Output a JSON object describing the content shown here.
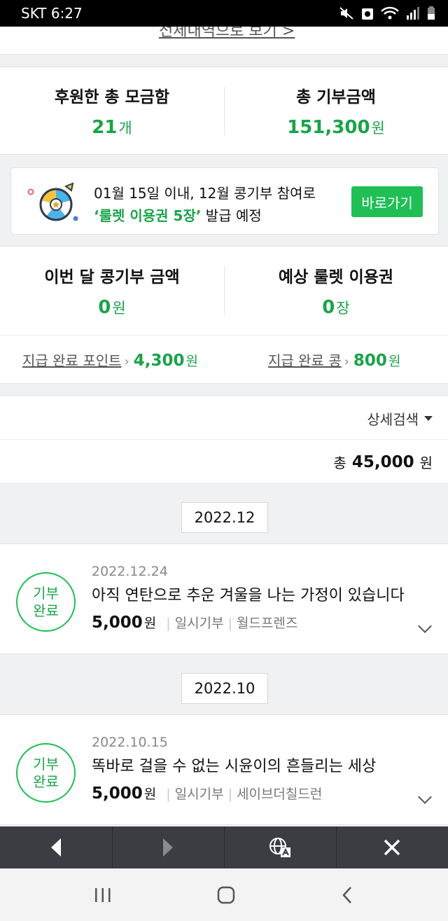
{
  "status_bar": {
    "carrier": "SKT",
    "time": "6:27"
  },
  "top_link": "전체내역으로 보기 >",
  "totals": {
    "boxes_label": "후원한 총 모금함",
    "boxes_value": "21",
    "boxes_unit": "개",
    "amount_label": "총 기부금액",
    "amount_value": "151,300",
    "amount_unit": "원"
  },
  "banner": {
    "line1": "01월 15일 이내, 12월 콩기부 참여로",
    "highlight": "‘룰렛 이용권 5장’",
    "line2_rest": "발급 예정",
    "button": "바로가기"
  },
  "month": {
    "donation_label": "이번 달 콩기부 금액",
    "donation_value": "0",
    "donation_unit": "원",
    "roulette_label": "예상 룰렛 이용권",
    "roulette_value": "0",
    "roulette_unit": "장",
    "points_link": "지급 완료 포인트",
    "points_value": "4,300",
    "points_unit": "원",
    "beans_link": "지급 완료 콩",
    "beans_value": "800",
    "beans_unit": "원"
  },
  "search": {
    "detail_label": "상세검색",
    "total_prefix": "총",
    "total_value": "45,000",
    "total_unit": "원"
  },
  "groups": [
    {
      "date": "2022.12",
      "item": {
        "status": "기부\n완료",
        "date": "2022.12.24",
        "title": "아직 연탄으로 추운 겨울을 나는 가정이 있습니다",
        "amount": "5,000",
        "unit": "원",
        "type": "일시기부",
        "org": "월드프렌즈"
      }
    },
    {
      "date": "2022.10",
      "item": {
        "status": "기부\n완료",
        "date": "2022.10.15",
        "title": "똑바로 걸을 수 없는 시윤이의 흔들리는 세상",
        "amount": "5,000",
        "unit": "원",
        "type": "일시기부",
        "org": "세이브더칠드런"
      }
    }
  ],
  "colors": {
    "accent": "#1aa34a",
    "button": "#1fbf55",
    "toolbar": "#3b3d42"
  },
  "icons": {
    "browser": [
      "back-arrow-icon",
      "forward-arrow-icon",
      "translate-globe-icon",
      "close-icon"
    ],
    "nav": [
      "recent-apps-icon",
      "home-icon",
      "back-icon"
    ]
  }
}
